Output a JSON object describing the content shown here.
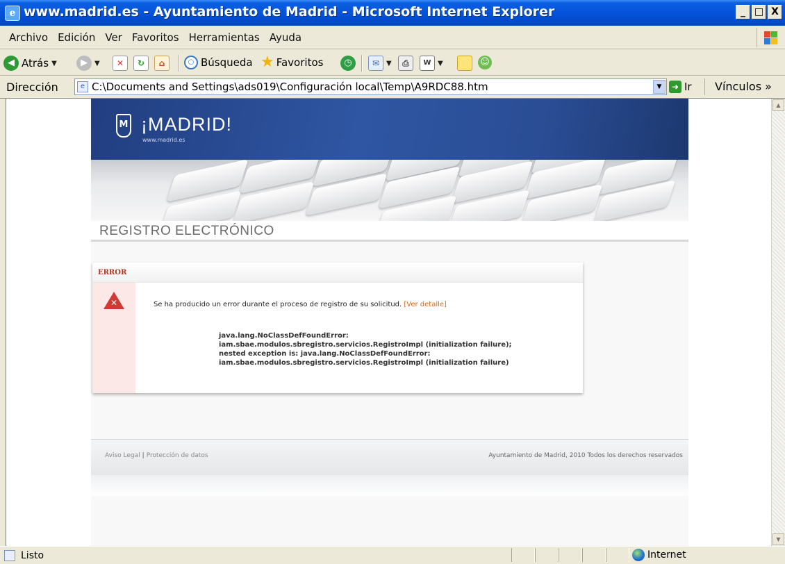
{
  "window": {
    "title": "www.madrid.es - Ayuntamiento de Madrid - Microsoft Internet Explorer",
    "minimize": "_",
    "maximize": "□",
    "close": "X"
  },
  "menu": [
    "Archivo",
    "Edición",
    "Ver",
    "Favoritos",
    "Herramientas",
    "Ayuda"
  ],
  "toolbar": {
    "back": "Atrás",
    "search": "Búsqueda",
    "favorites": "Favoritos"
  },
  "address": {
    "label": "Dirección",
    "url": "C:\\Documents and Settings\\ads019\\Configuración local\\Temp\\A9RDC88.htm",
    "go": "Ir",
    "links": "Vínculos »"
  },
  "page": {
    "logo_text": "¡MADRID!",
    "logo_site": "www.madrid.es",
    "section_title": "REGISTRO ELECTRÓNICO",
    "error": {
      "heading": "ERROR",
      "message": "Se ha producido un error durante el proceso de registro de su solicitud.",
      "detail_link": "[Ver detalle]",
      "exception_lines": [
        "java.lang.NoClassDefFoundError:",
        "iam.sbae.modulos.sbregistro.servicios.RegistroImpl (initialization failure);",
        "nested exception is: java.lang.NoClassDefFoundError:",
        "iam.sbae.modulos.sbregistro.servicios.RegistroImpl (initialization failure)"
      ]
    },
    "footer": {
      "aviso_legal": "Aviso Legal",
      "separator": "|",
      "proteccion": "Protección de datos",
      "copyright": "Ayuntamiento de Madrid, 2010 Todos los derechos reservados"
    }
  },
  "status": {
    "text": "Listo",
    "zone": "Internet"
  }
}
